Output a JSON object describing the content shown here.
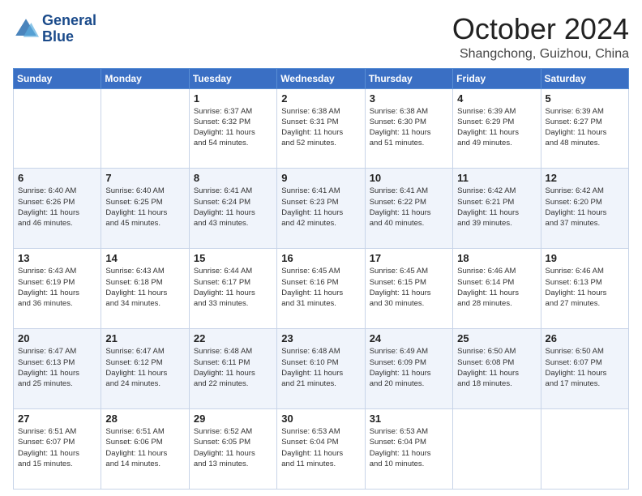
{
  "header": {
    "logo": {
      "line1": "General",
      "line2": "Blue"
    },
    "title": "October 2024",
    "location": "Shangchong, Guizhou, China"
  },
  "weekdays": [
    "Sunday",
    "Monday",
    "Tuesday",
    "Wednesday",
    "Thursday",
    "Friday",
    "Saturday"
  ],
  "weeks": [
    [
      {
        "day": "",
        "info": ""
      },
      {
        "day": "",
        "info": ""
      },
      {
        "day": "1",
        "info": "Sunrise: 6:37 AM\nSunset: 6:32 PM\nDaylight: 11 hours\nand 54 minutes."
      },
      {
        "day": "2",
        "info": "Sunrise: 6:38 AM\nSunset: 6:31 PM\nDaylight: 11 hours\nand 52 minutes."
      },
      {
        "day": "3",
        "info": "Sunrise: 6:38 AM\nSunset: 6:30 PM\nDaylight: 11 hours\nand 51 minutes."
      },
      {
        "day": "4",
        "info": "Sunrise: 6:39 AM\nSunset: 6:29 PM\nDaylight: 11 hours\nand 49 minutes."
      },
      {
        "day": "5",
        "info": "Sunrise: 6:39 AM\nSunset: 6:27 PM\nDaylight: 11 hours\nand 48 minutes."
      }
    ],
    [
      {
        "day": "6",
        "info": "Sunrise: 6:40 AM\nSunset: 6:26 PM\nDaylight: 11 hours\nand 46 minutes."
      },
      {
        "day": "7",
        "info": "Sunrise: 6:40 AM\nSunset: 6:25 PM\nDaylight: 11 hours\nand 45 minutes."
      },
      {
        "day": "8",
        "info": "Sunrise: 6:41 AM\nSunset: 6:24 PM\nDaylight: 11 hours\nand 43 minutes."
      },
      {
        "day": "9",
        "info": "Sunrise: 6:41 AM\nSunset: 6:23 PM\nDaylight: 11 hours\nand 42 minutes."
      },
      {
        "day": "10",
        "info": "Sunrise: 6:41 AM\nSunset: 6:22 PM\nDaylight: 11 hours\nand 40 minutes."
      },
      {
        "day": "11",
        "info": "Sunrise: 6:42 AM\nSunset: 6:21 PM\nDaylight: 11 hours\nand 39 minutes."
      },
      {
        "day": "12",
        "info": "Sunrise: 6:42 AM\nSunset: 6:20 PM\nDaylight: 11 hours\nand 37 minutes."
      }
    ],
    [
      {
        "day": "13",
        "info": "Sunrise: 6:43 AM\nSunset: 6:19 PM\nDaylight: 11 hours\nand 36 minutes."
      },
      {
        "day": "14",
        "info": "Sunrise: 6:43 AM\nSunset: 6:18 PM\nDaylight: 11 hours\nand 34 minutes."
      },
      {
        "day": "15",
        "info": "Sunrise: 6:44 AM\nSunset: 6:17 PM\nDaylight: 11 hours\nand 33 minutes."
      },
      {
        "day": "16",
        "info": "Sunrise: 6:45 AM\nSunset: 6:16 PM\nDaylight: 11 hours\nand 31 minutes."
      },
      {
        "day": "17",
        "info": "Sunrise: 6:45 AM\nSunset: 6:15 PM\nDaylight: 11 hours\nand 30 minutes."
      },
      {
        "day": "18",
        "info": "Sunrise: 6:46 AM\nSunset: 6:14 PM\nDaylight: 11 hours\nand 28 minutes."
      },
      {
        "day": "19",
        "info": "Sunrise: 6:46 AM\nSunset: 6:13 PM\nDaylight: 11 hours\nand 27 minutes."
      }
    ],
    [
      {
        "day": "20",
        "info": "Sunrise: 6:47 AM\nSunset: 6:13 PM\nDaylight: 11 hours\nand 25 minutes."
      },
      {
        "day": "21",
        "info": "Sunrise: 6:47 AM\nSunset: 6:12 PM\nDaylight: 11 hours\nand 24 minutes."
      },
      {
        "day": "22",
        "info": "Sunrise: 6:48 AM\nSunset: 6:11 PM\nDaylight: 11 hours\nand 22 minutes."
      },
      {
        "day": "23",
        "info": "Sunrise: 6:48 AM\nSunset: 6:10 PM\nDaylight: 11 hours\nand 21 minutes."
      },
      {
        "day": "24",
        "info": "Sunrise: 6:49 AM\nSunset: 6:09 PM\nDaylight: 11 hours\nand 20 minutes."
      },
      {
        "day": "25",
        "info": "Sunrise: 6:50 AM\nSunset: 6:08 PM\nDaylight: 11 hours\nand 18 minutes."
      },
      {
        "day": "26",
        "info": "Sunrise: 6:50 AM\nSunset: 6:07 PM\nDaylight: 11 hours\nand 17 minutes."
      }
    ],
    [
      {
        "day": "27",
        "info": "Sunrise: 6:51 AM\nSunset: 6:07 PM\nDaylight: 11 hours\nand 15 minutes."
      },
      {
        "day": "28",
        "info": "Sunrise: 6:51 AM\nSunset: 6:06 PM\nDaylight: 11 hours\nand 14 minutes."
      },
      {
        "day": "29",
        "info": "Sunrise: 6:52 AM\nSunset: 6:05 PM\nDaylight: 11 hours\nand 13 minutes."
      },
      {
        "day": "30",
        "info": "Sunrise: 6:53 AM\nSunset: 6:04 PM\nDaylight: 11 hours\nand 11 minutes."
      },
      {
        "day": "31",
        "info": "Sunrise: 6:53 AM\nSunset: 6:04 PM\nDaylight: 11 hours\nand 10 minutes."
      },
      {
        "day": "",
        "info": ""
      },
      {
        "day": "",
        "info": ""
      }
    ]
  ]
}
